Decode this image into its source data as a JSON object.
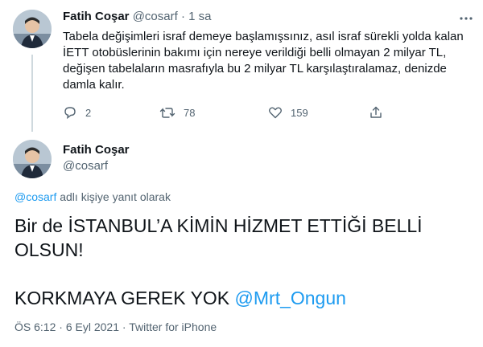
{
  "tweet1": {
    "author_name": "Fatih Coşar",
    "handle": "@cosarf",
    "separator": "·",
    "time_ago": "1 sa",
    "text": "Tabela değişimleri israf demeye başlamışsınız, asıl israf sürekli yolda kalan İETT otobüslerinin bakımı için nereye verildiği belli olmayan 2 milyar TL, değişen tabelaların masrafıyla bu 2 milyar TL karşılaştıralamaz, denizde damla kalır.",
    "reply_count": "2",
    "retweet_count": "78",
    "like_count": "159",
    "icons": [
      "reply-icon",
      "retweet-icon",
      "like-icon",
      "more-icon"
    ]
  },
  "tweet2": {
    "author_name": "Fatih Coşar",
    "handle": "@cosarf",
    "replying_handle": "@cosarf",
    "replying_text": " adlı kişiye yanıt olarak",
    "text_line1": "Bir de İSTANBUL’A KİMİN HİZMET ETTİĞİ BELLİ OLSUN!",
    "text_line2_prefix": "KORKMAYA GEREK YOK ",
    "text_line2_mention": "@Mrt_Ongun",
    "time": "ÖS 6:12",
    "separator": "·",
    "date": "6 Eyl 2021",
    "source": "Twitter for iPhone"
  },
  "colors": {
    "link": "#1d9bf0",
    "muted": "#536471",
    "text": "#0f1419",
    "divider": "#cfd9de"
  }
}
